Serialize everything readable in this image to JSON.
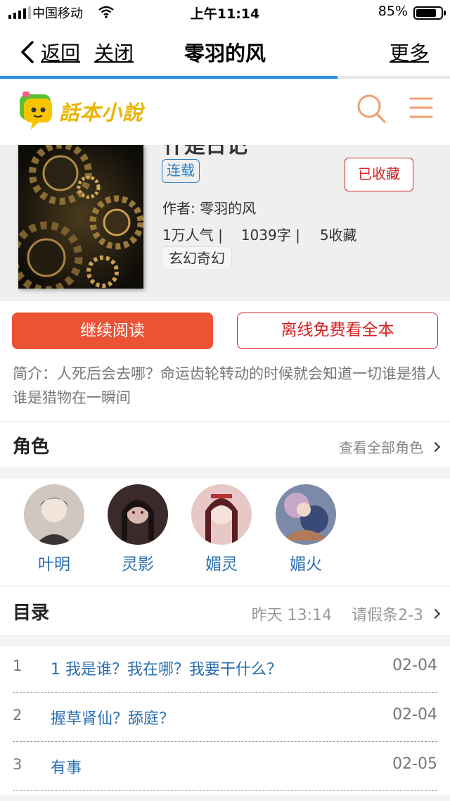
{
  "status_bar": {
    "carrier": "中国移动",
    "time": "上午11:14",
    "battery_percent": "85%",
    "battery_level": 0.85
  },
  "nav": {
    "back_label": "返回",
    "close_label": "关闭",
    "title": "零羽的风",
    "more_label": "更多",
    "load_progress": 0.75
  },
  "site": {
    "logo_text": "話本小說"
  },
  "book": {
    "title_partial": "什是日记",
    "status_badge": "连载",
    "collect_label": "已收藏",
    "author": "作者: 零羽的风",
    "popularity": "1万人气 |",
    "word_count": "1039字 |",
    "favorites": "5收藏",
    "genre": "玄幻奇幻"
  },
  "actions": {
    "continue_reading": "继续阅读",
    "offline_read": "离线免费看全本"
  },
  "intro": "简介：人死后会去哪？命运齿轮转动的时候就会知道一切谁是猎人谁是猎物在一瞬间",
  "characters": {
    "heading": "角色",
    "view_all": "查看全部角色",
    "items": [
      {
        "name": "叶明"
      },
      {
        "name": "灵影"
      },
      {
        "name": "媚灵"
      },
      {
        "name": "媚火"
      }
    ]
  },
  "toc": {
    "heading": "目录",
    "updated": "昨天 13:14",
    "latest": "请假条2-3",
    "chapters": [
      {
        "num": "1",
        "title": "1 我是谁？我在哪？我要干什么？",
        "date": "02-04"
      },
      {
        "num": "2",
        "title": "握草肾仙？舔庭？",
        "date": "02-04"
      },
      {
        "num": "3",
        "title": "有事",
        "date": "02-05"
      }
    ]
  },
  "colors": {
    "accent_red": "#d32323",
    "button_orange": "#ec5234",
    "link_blue": "#2a6fb0",
    "progress_blue": "#2a8fe0"
  }
}
